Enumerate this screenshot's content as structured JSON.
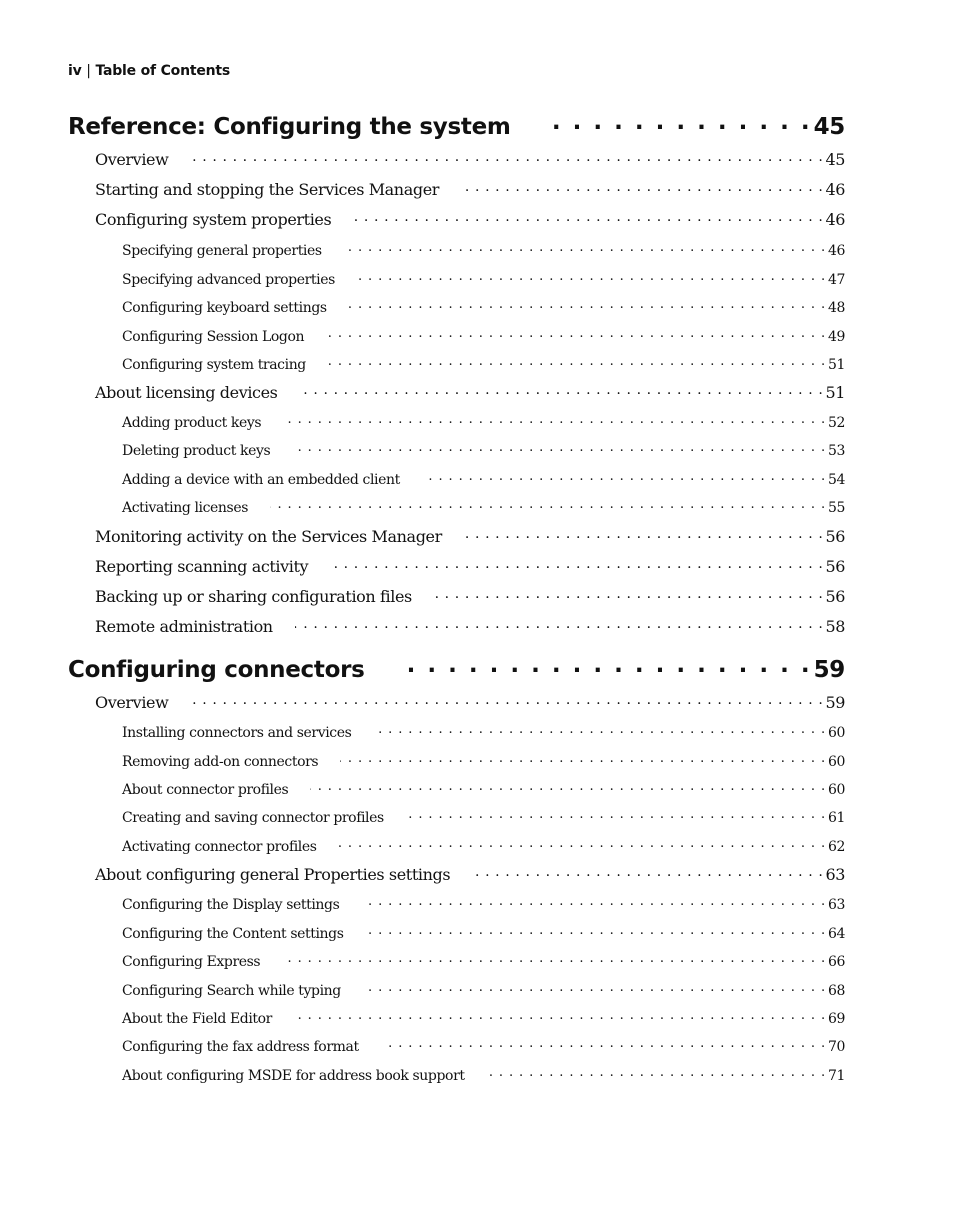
{
  "header": {
    "page_number": "iv",
    "separator": "|",
    "section": "Table of Contents"
  },
  "toc": [
    {
      "level": 0,
      "title": "Reference: Configuring the system",
      "page": "45"
    },
    {
      "level": 1,
      "title": "Overview",
      "page": "45"
    },
    {
      "level": 1,
      "title": "Starting and stopping the Services Manager",
      "page": "46"
    },
    {
      "level": 1,
      "title": "Configuring system properties",
      "page": "46"
    },
    {
      "level": 2,
      "title": "Specifying general properties",
      "page": "46"
    },
    {
      "level": 2,
      "title": "Specifying advanced properties",
      "page": "47"
    },
    {
      "level": 2,
      "title": "Configuring keyboard settings",
      "page": "48"
    },
    {
      "level": 2,
      "title": "Configuring Session Logon",
      "page": "49"
    },
    {
      "level": 2,
      "title": "Configuring system tracing",
      "page": "51"
    },
    {
      "level": 1,
      "title": "About licensing devices",
      "page": "51"
    },
    {
      "level": 2,
      "title": "Adding product keys",
      "page": "52"
    },
    {
      "level": 2,
      "title": "Deleting product keys",
      "page": "53"
    },
    {
      "level": 2,
      "title": "Adding a device with an embedded client",
      "page": "54"
    },
    {
      "level": 2,
      "title": "Activating licenses",
      "page": "55"
    },
    {
      "level": 1,
      "title": "Monitoring activity on the Services Manager",
      "page": "56"
    },
    {
      "level": 1,
      "title": "Reporting scanning activity",
      "page": "56"
    },
    {
      "level": 1,
      "title": "Backing up or sharing configuration files",
      "page": "56"
    },
    {
      "level": 1,
      "title": "Remote administration",
      "page": "58"
    },
    {
      "level": 0,
      "title": "Configuring connectors",
      "page": "59"
    },
    {
      "level": 1,
      "title": "Overview",
      "page": "59"
    },
    {
      "level": 2,
      "title": "Installing connectors and services",
      "page": "60"
    },
    {
      "level": 2,
      "title": "Removing add-on connectors",
      "page": "60"
    },
    {
      "level": 2,
      "title": "About connector profiles",
      "page": "60"
    },
    {
      "level": 2,
      "title": "Creating and saving connector profiles",
      "page": "61"
    },
    {
      "level": 2,
      "title": "Activating connector profiles",
      "page": "62"
    },
    {
      "level": 1,
      "title": "About configuring general Properties settings",
      "page": "63"
    },
    {
      "level": 2,
      "title": "Configuring the Display settings",
      "page": "63"
    },
    {
      "level": 2,
      "title": "Configuring the Content settings",
      "page": "64"
    },
    {
      "level": 2,
      "title": "Configuring Express",
      "page": "66"
    },
    {
      "level": 2,
      "title": "Configuring Search while typing",
      "page": "68"
    },
    {
      "level": 2,
      "title": "About the Field Editor",
      "page": "69"
    },
    {
      "level": 2,
      "title": "Configuring the fax address format",
      "page": "70"
    },
    {
      "level": 2,
      "title": "About configuring MSDE for address book support",
      "page": "71"
    }
  ]
}
